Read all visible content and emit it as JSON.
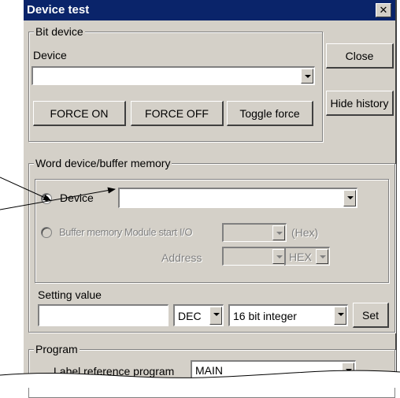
{
  "window": {
    "title": "Device test",
    "close_glyph": "✕"
  },
  "bit_device": {
    "legend": "Bit device",
    "device_label": "Device",
    "device_value": "",
    "force_on": "FORCE ON",
    "force_off": "FORCE OFF",
    "toggle_force": "Toggle force"
  },
  "side_buttons": {
    "close": "Close",
    "hide_history": "Hide history"
  },
  "word_device": {
    "legend": "Word device/buffer memory",
    "device_radio": "Device",
    "device_value": "",
    "buffer_radio": "Buffer memory Module start I/O",
    "hex_label": "(Hex)",
    "address_label": "Address",
    "address_format": "HEX"
  },
  "setting": {
    "label": "Setting value",
    "value": "",
    "radix": "DEC",
    "data_type": "16 bit integer",
    "set": "Set"
  },
  "program": {
    "legend": "Program",
    "label_ref": "Label reference program",
    "value": "MAIN"
  }
}
